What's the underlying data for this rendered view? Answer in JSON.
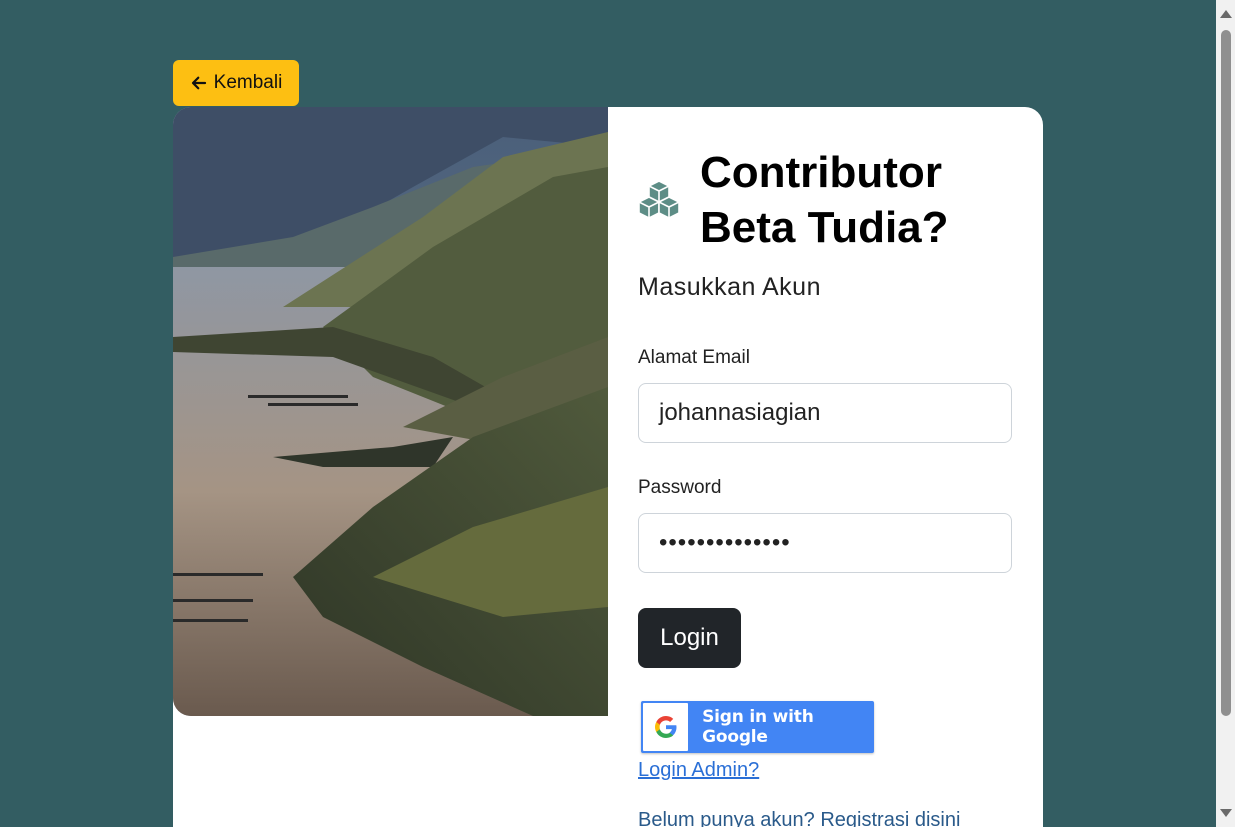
{
  "back_button": {
    "label": "Kembali",
    "icon": "arrow-left-icon"
  },
  "heading": {
    "title": "Contributor Beta Tudia?",
    "logo_icon": "cubes-icon",
    "logo_color": "#5d8d86"
  },
  "subtitle": "Masukkan Akun",
  "email": {
    "label": "Alamat Email",
    "value": "johannasiagian"
  },
  "password": {
    "label": "Password",
    "value": "••••••••••••••"
  },
  "login_button": {
    "label": "Login"
  },
  "google_button": {
    "label": "Sign in with Google"
  },
  "admin_link": "Login Admin?",
  "register_text": "Belum punya akun? Registrasi disini",
  "colors": {
    "background": "#335d62",
    "accent": "#fdbf12",
    "google_blue": "#4285f4",
    "button_dark": "#212529"
  }
}
